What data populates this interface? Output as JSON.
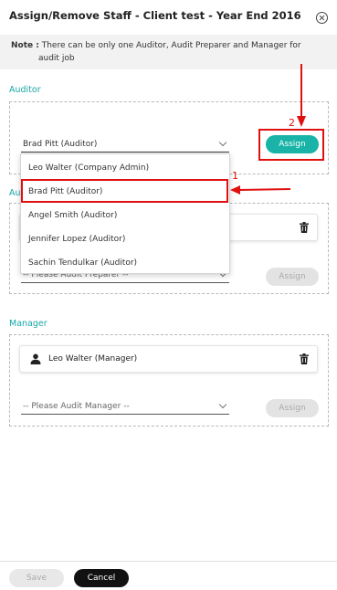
{
  "dialog": {
    "title": "Assign/Remove Staff - Client test - Year End 2016",
    "note_label": "Note :",
    "note_line1": "There can be only one Auditor, Audit Preparer and Manager for",
    "note_line2": "audit job"
  },
  "auditor": {
    "label": "Auditor",
    "selected": "Brad Pitt (Auditor)",
    "assign_label": "Assign"
  },
  "audit_preparer": {
    "label_visible": "Aud",
    "placeholder": "-- Please Audit Preparer --",
    "assign_label": "Assign"
  },
  "dropdown": {
    "options": [
      "Leo Walter (Company Admin)",
      "Brad Pitt (Auditor)",
      "Angel Smith (Auditor)",
      "Jennifer Lopez (Auditor)",
      "Sachin Tendulkar (Auditor)"
    ],
    "highlighted_index": 1
  },
  "manager": {
    "label": "Manager",
    "assigned": "Leo Walter (Manager)",
    "placeholder": "-- Please Audit Manager --",
    "assign_label": "Assign"
  },
  "footer": {
    "save_label": "Save",
    "cancel_label": "Cancel"
  },
  "annotations": {
    "step1": "1",
    "step2": "2",
    "color": "#e01010"
  },
  "colors": {
    "accent": "#19b3a7",
    "section_label": "#1aa6a6"
  },
  "icons": [
    "close-icon",
    "chevron-down-icon",
    "person-icon",
    "trash-icon",
    "arrow-icon"
  ]
}
